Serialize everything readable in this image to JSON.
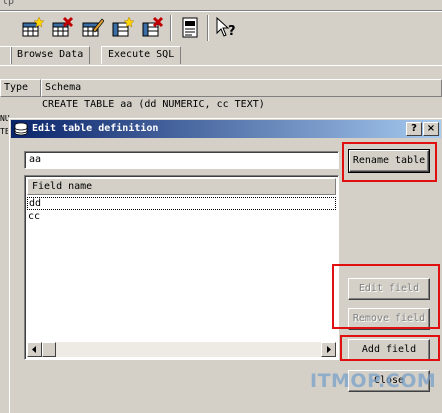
{
  "menu": {
    "fragment": "lp"
  },
  "toolbar": {
    "buttons": [
      {
        "icon": "new-table-icon"
      },
      {
        "icon": "delete-table-icon"
      },
      {
        "icon": "modify-table-icon"
      },
      {
        "icon": "new-index-icon"
      },
      {
        "icon": "delete-index-icon"
      },
      {
        "icon": "log-icon"
      },
      {
        "icon": "whats-this-help-icon"
      }
    ]
  },
  "tabs": [
    {
      "label": ""
    },
    {
      "label": "Browse Data"
    },
    {
      "label": "Execute SQL"
    }
  ],
  "grid": {
    "col_type": "Type",
    "col_schema": "Schema",
    "row_schema": "CREATE TABLE aa (dd NUMERIC, cc TEXT)",
    "left_fragments": [
      "NU",
      "TE"
    ]
  },
  "dialog": {
    "title": "Edit table definition",
    "help_button": "?",
    "close_button": "×",
    "table_name": "aa",
    "rename_button": "Rename table",
    "list_header": "Field name",
    "fields": [
      "dd",
      "cc"
    ],
    "edit_field_button": "Edit field",
    "remove_field_button": "Remove field",
    "add_field_button": "Add field",
    "close_dialog_button": "Close"
  },
  "watermark": "ITMOP.COM",
  "colors": {
    "titlebar_start": "#0a246a",
    "titlebar_end": "#a6caf0",
    "highlight": "#e01010",
    "face": "#d4d0c8"
  }
}
